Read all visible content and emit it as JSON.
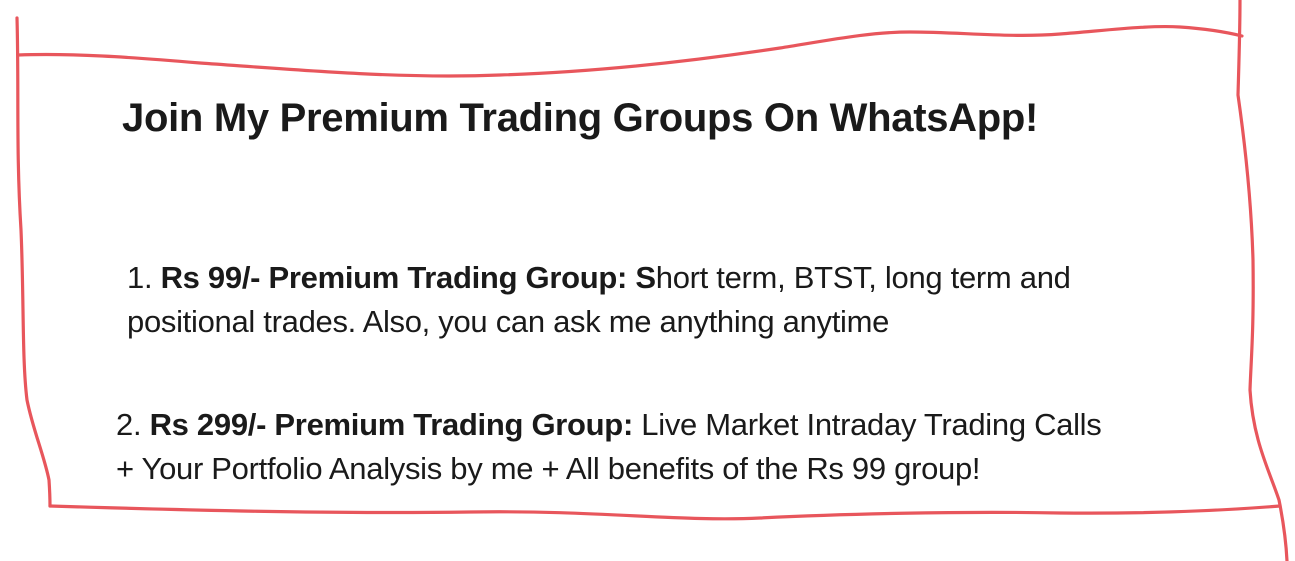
{
  "border": {
    "color": "#e8565c"
  },
  "heading": "Join My Premium Trading Groups On WhatsApp!",
  "items": [
    {
      "number": "1.",
      "price": "Rs 99/-",
      "name": "Premium Trading Group:",
      "lead_letter": "S",
      "line1_rest": "hort term, BTST, long term and",
      "line2": "positional trades. Also, you can ask me anything anytime"
    },
    {
      "number": "2.",
      "price": "Rs 299/-",
      "name": "Premium Trading Group:",
      "line1_rest": "Live Market Intraday Trading Calls",
      "line2": "+ Your Portfolio Analysis by me + All benefits of the Rs 99 group!"
    }
  ]
}
